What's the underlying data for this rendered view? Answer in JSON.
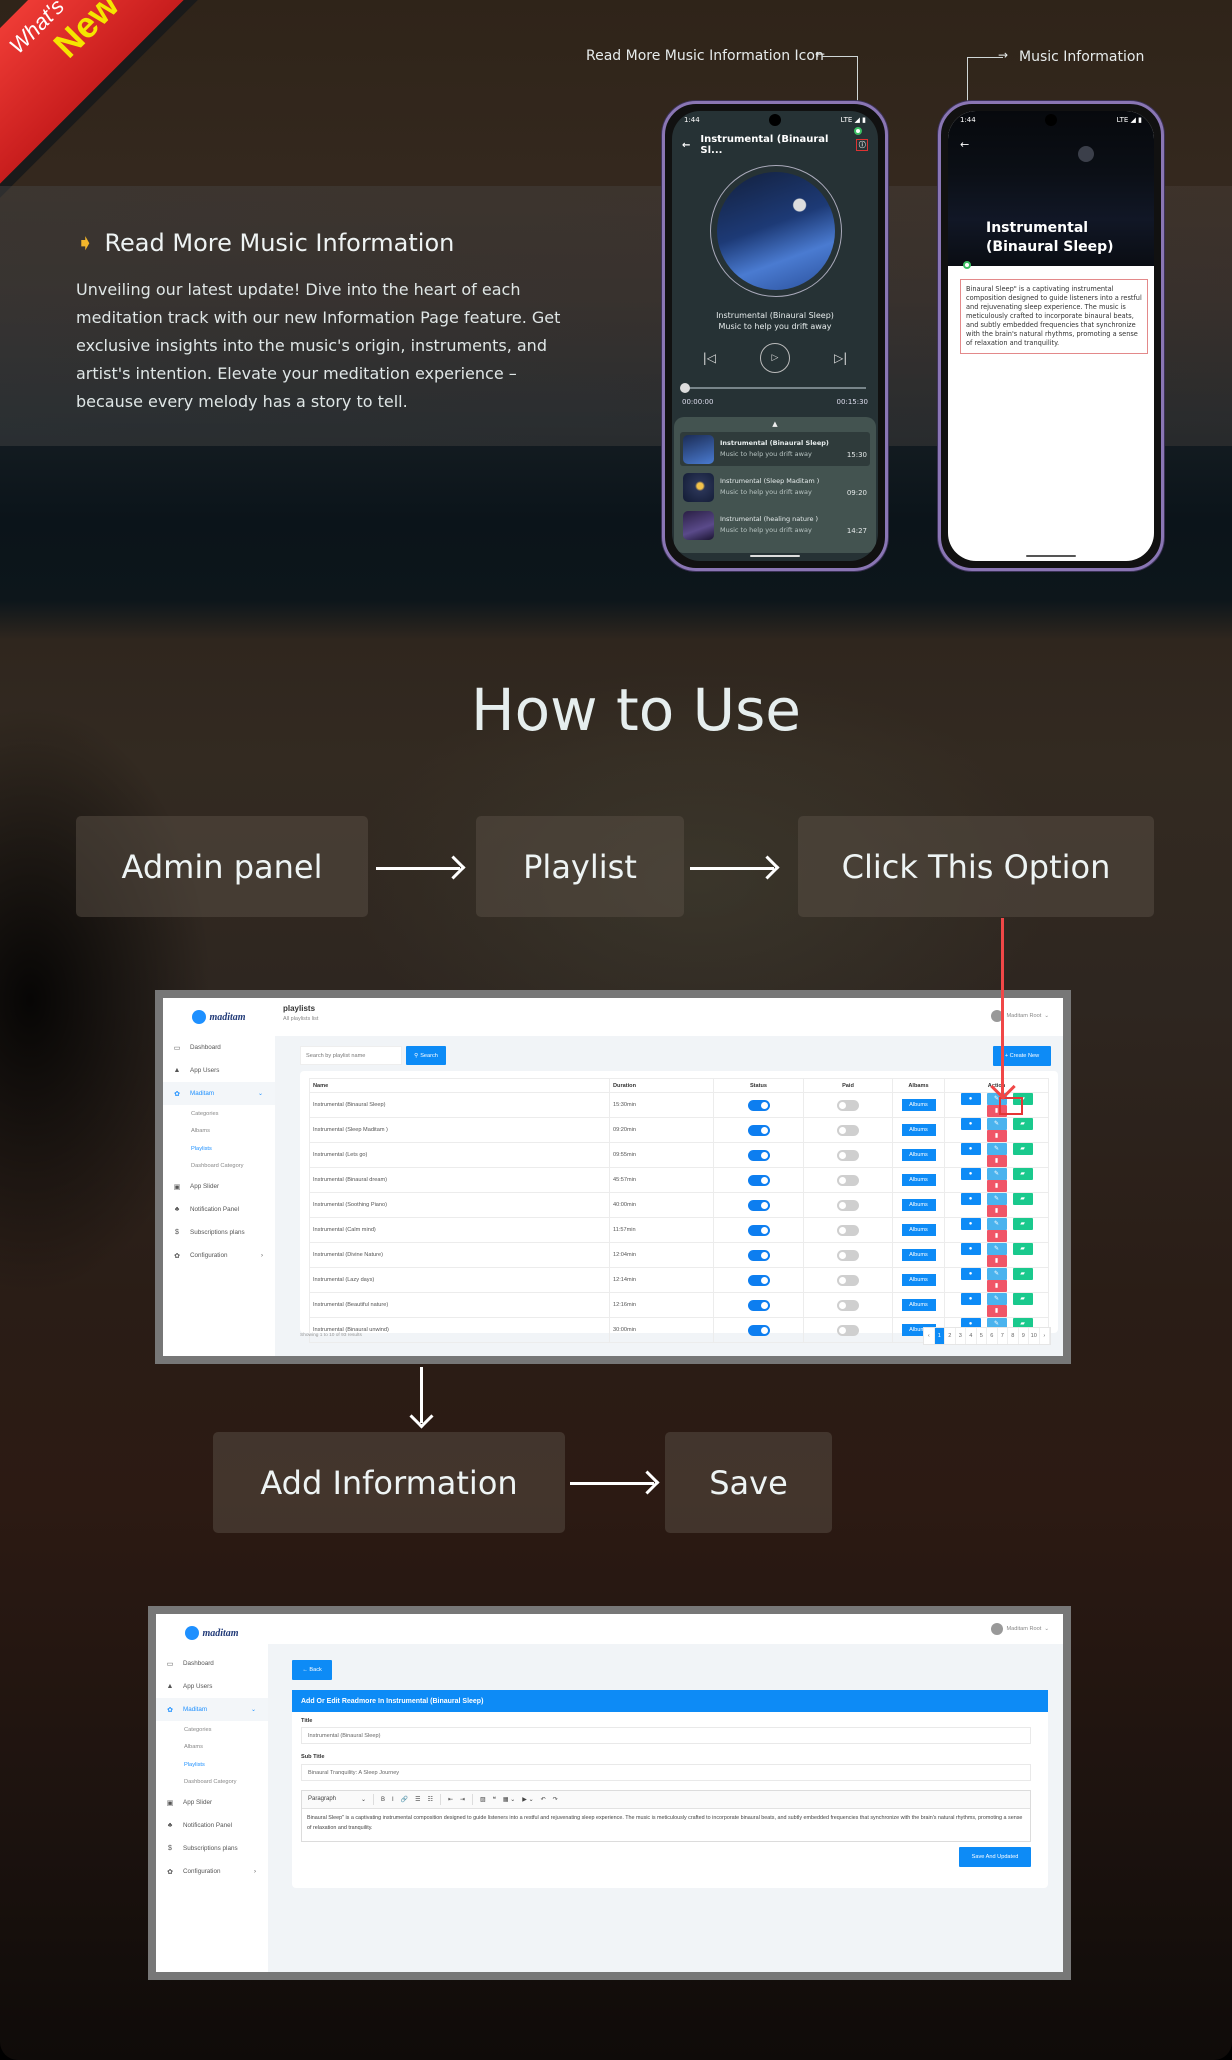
{
  "ribbon": {
    "line1": "What's",
    "line2": "New !"
  },
  "feature": {
    "icon": "arrow-right-icon",
    "title": "Read More Music Information",
    "body": "Unveiling our latest update! Dive into the heart of each meditation track with our new Information Page feature. Get exclusive insights into the music's origin, instruments, and artist's intention. Elevate your meditation experience – because every melody has a story to tell."
  },
  "callouts": {
    "icon_label": "Read More Music Information Icon",
    "info_label": "Music Information"
  },
  "phone_player": {
    "status_time": "1:44",
    "status_right": "LTE ◢ ▮",
    "header_title": "Instrumental (Binaural Sl...",
    "track_title": "Instrumental (Binaural Sleep)",
    "track_subtitle": "Music to help you drift away",
    "time_elapsed": "00:00:00",
    "time_total": "00:15:30",
    "progress": 0,
    "queue": [
      {
        "title": "Instrumental (Binaural Sleep)",
        "subtitle": "Music to help you drift away",
        "duration": "15:30",
        "active": true
      },
      {
        "title": "Instrumental (Sleep Maditam )",
        "subtitle": "Music to help you drift away",
        "duration": "09:20",
        "active": false
      },
      {
        "title": "Instrumental (healing nature )",
        "subtitle": "Music to help you drift away",
        "duration": "14:27",
        "active": false
      }
    ]
  },
  "phone_info": {
    "status_time": "1:44",
    "status_right": "LTE ◢ ▮",
    "title": "Instrumental (Binaural Sleep)",
    "description": "Binaural Sleep\" is a captivating instrumental composition designed to guide listeners into a restful and rejuvenating sleep experience. The music is meticulously crafted to incorporate binaural beats, and subtly embedded frequencies that synchronize with the brain's natural rhythms, promoting a sense of relaxation and tranquility."
  },
  "how_to_use": {
    "title": "How to Use",
    "steps": [
      "Admin panel",
      "Playlist",
      "Click This Option",
      "Add Information",
      "Save"
    ]
  },
  "admin": {
    "brand": "maditam",
    "user": "Maditam Root",
    "nav": [
      {
        "icon": "monitor-icon",
        "glyph": "▭",
        "label": "Dashboard"
      },
      {
        "icon": "user-icon",
        "glyph": "▲",
        "label": "App Users"
      },
      {
        "icon": "meditation-icon",
        "glyph": "✿",
        "label": "Maditam",
        "active": true,
        "chevron": "⌄"
      },
      {
        "icon": "image-icon",
        "glyph": "▣",
        "label": "App Slider"
      },
      {
        "icon": "bell-icon",
        "glyph": "♣",
        "label": "Notification Panel"
      },
      {
        "icon": "dollar-icon",
        "glyph": "$",
        "label": "Subscriptions plans"
      },
      {
        "icon": "config-icon",
        "glyph": "✿",
        "label": "Configuration",
        "chevron": "›"
      }
    ],
    "subnav": [
      "Categories",
      "Albams",
      "Playlists",
      "Dashboard Category"
    ],
    "subnav_active": "Playlists"
  },
  "playlists": {
    "page_title": "playlists",
    "page_subtitle": "All playlists list",
    "search_placeholder": "Search by playlist name",
    "search_button": "Search",
    "create_button": "+ Create New",
    "columns": [
      "Name",
      "Duration",
      "Status",
      "Paid",
      "Albams",
      "Action"
    ],
    "rows": [
      {
        "name": "Instrumental (Binaural Sleep)",
        "duration": "15:30min",
        "status": true,
        "paid": false
      },
      {
        "name": "Instrumental (Sleep Maditam )",
        "duration": "09:20min",
        "status": true,
        "paid": false
      },
      {
        "name": "Instrumental (Lets go)",
        "duration": "09:55min",
        "status": true,
        "paid": false
      },
      {
        "name": "Instrumental (Binaural dream)",
        "duration": "45:57min",
        "status": true,
        "paid": false
      },
      {
        "name": "Instrumental (Soothing Piano)",
        "duration": "40:00min",
        "status": true,
        "paid": false
      },
      {
        "name": "Instrumental (Calm mind)",
        "duration": "11:57min",
        "status": true,
        "paid": false
      },
      {
        "name": "Instrumental (Divine Nature)",
        "duration": "12:04min",
        "status": true,
        "paid": false
      },
      {
        "name": "Instrumental (Lazy days)",
        "duration": "12:14min",
        "status": true,
        "paid": false
      },
      {
        "name": "Instrumental (Beautiful nature)",
        "duration": "12:16min",
        "status": true,
        "paid": false
      },
      {
        "name": "Instrumental (Binaural unwind)",
        "duration": "30:00min",
        "status": true,
        "paid": false
      }
    ],
    "albums_label": "Albums",
    "actions": [
      {
        "name": "view",
        "icon": "eye-icon",
        "glyph": "●",
        "color": "#0d8bf6"
      },
      {
        "name": "edit",
        "icon": "edit-icon",
        "glyph": "✎",
        "color": "#4ab3ee"
      },
      {
        "name": "readmore",
        "icon": "book-icon",
        "glyph": "▰",
        "color": "#1ac98d"
      },
      {
        "name": "delete",
        "icon": "trash-icon",
        "glyph": "▮",
        "color": "#f05567"
      }
    ],
    "footer": "Showing 1 to 10 of 93 results",
    "pages": [
      "‹",
      "1",
      "2",
      "3",
      "4",
      "5",
      "6",
      "7",
      "8",
      "9",
      "10",
      "›"
    ],
    "current_page": "1"
  },
  "edit_form": {
    "back_button": "← Back",
    "header": "Add Or Edit Readmore In Instrumental (Binaural Sleep)",
    "title_label": "Title",
    "title_value": "Instrumental (Binaural Sleep)",
    "subtitle_label": "Sub Title",
    "subtitle_value": "Binaural Tranquility: A Sleep Journey",
    "editor_format": "Paragraph",
    "editor_tools": [
      "B",
      "I",
      "🔗",
      "☰",
      "☷",
      "⇤",
      "⇥",
      "▨",
      "❝",
      "▦ ⌄",
      "▶ ⌄",
      "↶",
      "↷"
    ],
    "editor_text": "Binaural Sleep\" is a captivating instrumental composition designed to guide listeners into a restful and rejuvenating sleep experience. The music is meticulously crafted to incorporate binaural beats, and subtly embedded frequencies that synchronize with the brain's natural rhythms, promoting a sense of relaxation and tranquility.",
    "save_button": "Save And Updated"
  },
  "colors": {
    "accent": "#0d8bf6",
    "highlight": "#e53535",
    "ribbon": "#d82626",
    "ribbon_text": "#f5e500"
  }
}
